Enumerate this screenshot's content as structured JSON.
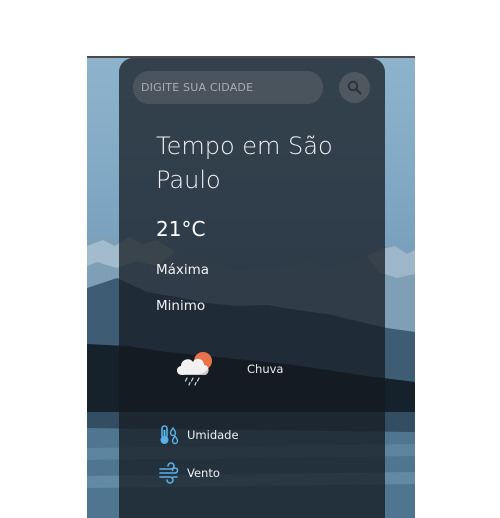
{
  "search": {
    "placeholder": "DIGITE SUA CIDADE",
    "value": ""
  },
  "weather": {
    "city_title": "Tempo em São Paulo",
    "temperature": "21°C",
    "max_label": "Máxima",
    "min_label": "Minimo",
    "condition": "Chuva",
    "humidity_label": "Umidade",
    "wind_label": "Vento"
  },
  "icons": {
    "search": "search-icon",
    "condition": "rain-cloud-sun-icon",
    "humidity": "thermometer-droplets-icon",
    "wind": "wind-icon"
  },
  "colors": {
    "card_background": "#141a20",
    "text_primary": "#f2f2f2",
    "icon_accent": "#5ab0e6",
    "sun": "#e8724a"
  }
}
